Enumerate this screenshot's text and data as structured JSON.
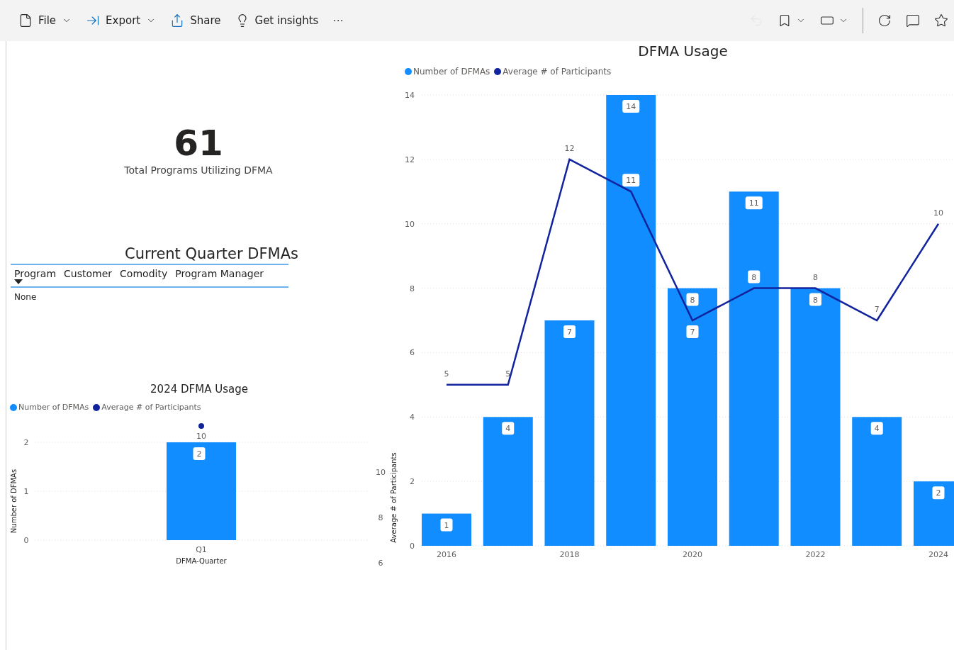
{
  "toolbar": {
    "items": [
      {
        "label": "File",
        "kind": "file",
        "dropdown": true
      },
      {
        "label": "Export",
        "kind": "export",
        "dropdown": true
      },
      {
        "label": "Share",
        "kind": "share",
        "dropdown": false
      },
      {
        "label": "Get insights",
        "kind": "insights",
        "dropdown": false
      },
      {
        "label": "⋯",
        "kind": "more",
        "dropdown": false
      }
    ],
    "right_tools": [
      {
        "kind": "undo",
        "disabled": true,
        "dropdown": false
      },
      {
        "kind": "bookmark",
        "disabled": false,
        "dropdown": true
      },
      {
        "kind": "view",
        "disabled": false,
        "dropdown": true
      },
      {
        "kind": "refresh",
        "disabled": false,
        "dropdown": false
      },
      {
        "kind": "comment",
        "disabled": false,
        "dropdown": false
      },
      {
        "kind": "favorite",
        "disabled": false,
        "dropdown": false
      }
    ]
  },
  "card": {
    "value": "61",
    "label": "Total Programs Utilizing DFMA"
  },
  "table": {
    "title": "Current Quarter DFMAs",
    "columns": [
      {
        "label": "Program",
        "sorted": true
      },
      {
        "label": "Customer",
        "sorted": false
      },
      {
        "label": "Comodity",
        "sorted": false
      },
      {
        "label": "Program Manager",
        "sorted": false
      }
    ],
    "rows": [
      [
        "None"
      ]
    ]
  },
  "quarter_chart": {
    "chart_data": {
      "type": "bar",
      "title": "2024 DFMA Usage",
      "xlabel": "DFMA-Quarter",
      "ylabel": "Number of DFMAs",
      "categories": [
        "Q1"
      ],
      "series": [
        {
          "name": "Number of DFMAs",
          "color": "#118dff",
          "values": [
            2
          ]
        }
      ],
      "ylim": [
        0,
        2
      ],
      "yticks": [
        0,
        1,
        2
      ],
      "grid": true,
      "data_labels": true
    },
    "secondary": {
      "name": "Average # of Participants",
      "color": "#12239e",
      "axis_title": "Average # of Participants",
      "ticks": [
        "10",
        "8",
        "6"
      ],
      "point_label": "10"
    }
  },
  "usage_chart": {
    "chart_data": {
      "type": "bar",
      "title": "DFMA Usage",
      "x": [
        2016,
        2017,
        2018,
        2019,
        2020,
        2021,
        2022,
        2023,
        2024
      ],
      "series": [
        {
          "name": "Number of DFMAs",
          "color": "#118dff",
          "values": [
            1,
            4,
            7,
            14,
            8,
            11,
            8,
            4,
            2
          ]
        },
        {
          "name": "Average # of Participants",
          "color": "#12239e",
          "values": [
            5,
            5,
            12,
            11,
            7,
            8,
            8,
            7,
            10
          ],
          "type": "line"
        }
      ],
      "xlim": [
        2015.6,
        2024.27
      ],
      "ylim": [
        0,
        14
      ],
      "yticks": [
        0,
        2,
        4,
        6,
        8,
        10,
        12,
        14
      ],
      "xticks": [
        2016,
        2018,
        2020,
        2022,
        2024
      ],
      "grid": true,
      "data_labels": true
    }
  }
}
